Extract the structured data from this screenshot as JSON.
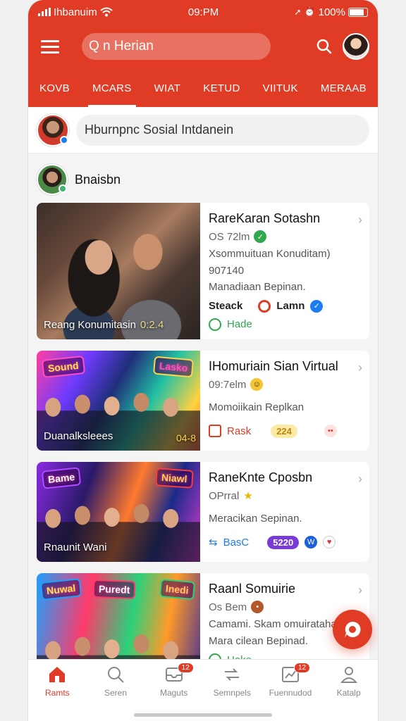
{
  "status": {
    "carrier": "Ihbanuim",
    "time": "09:PM",
    "battery": "100%"
  },
  "header": {
    "search_text": "Q n Herian"
  },
  "tabs": [
    {
      "label": "KOVB",
      "active": false
    },
    {
      "label": "MCARS",
      "active": true
    },
    {
      "label": "WIAT",
      "active": false
    },
    {
      "label": "KETUD",
      "active": false
    },
    {
      "label": "VIITUK",
      "active": false
    },
    {
      "label": "MERAAB",
      "active": false
    }
  ],
  "composer": {
    "placeholder": "Hburnpnc Sosial Intdanein"
  },
  "section": {
    "title": "Bnaisbn"
  },
  "posts": [
    {
      "title": "RareKaran Sotashn",
      "meta": "OS 72lm",
      "desc1": "Xsommuituan Konuditam)",
      "desc2": "907140",
      "desc3": "Manadiaan Bepinan.",
      "thumb_caption": "Reang Konumitasin",
      "thumb_badge": "0:2.4",
      "action1": "Steack",
      "action2": "Lamn",
      "footer": "Hade"
    },
    {
      "title": "IHomuriain Sian Virtual",
      "meta": "09:7elm",
      "desc1": "Momoiikain Replkan",
      "thumb_caption": "Duanalksleees",
      "thumb_badge": "04-8",
      "neon1": "Sound",
      "neon2": "Lasko",
      "action1": "Rask",
      "pill": "224"
    },
    {
      "title": "RaneKnte Cposbn",
      "meta": "OPrral",
      "desc1": "Meracikan Sepinan.",
      "thumb_caption": "Rnaunit Wani",
      "neon1": "Bame",
      "neon2": "Niawl",
      "action1": "BasC",
      "pill": "5220"
    },
    {
      "title": "Raanl Somuirie",
      "meta": "Os Bem",
      "desc1": "Camami. Skam omuiratahal",
      "desc2": "Mara cilean Bepinad.",
      "neon1": "Nuwal",
      "neon2": "Puredt",
      "neon3": "Inedi",
      "footer": "Hake"
    }
  ],
  "bottom_nav": [
    {
      "label": "Ramts",
      "active": true
    },
    {
      "label": "Seren",
      "active": false
    },
    {
      "label": "Maguts",
      "active": false,
      "badge": "12"
    },
    {
      "label": "Semnpels",
      "active": false
    },
    {
      "label": "Fuennudod",
      "active": false,
      "badge": "12"
    },
    {
      "label": "Katalp",
      "active": false
    }
  ],
  "colors": {
    "brand": "#e03b25",
    "verified": "#1d7cf2",
    "online": "#3cb371"
  }
}
